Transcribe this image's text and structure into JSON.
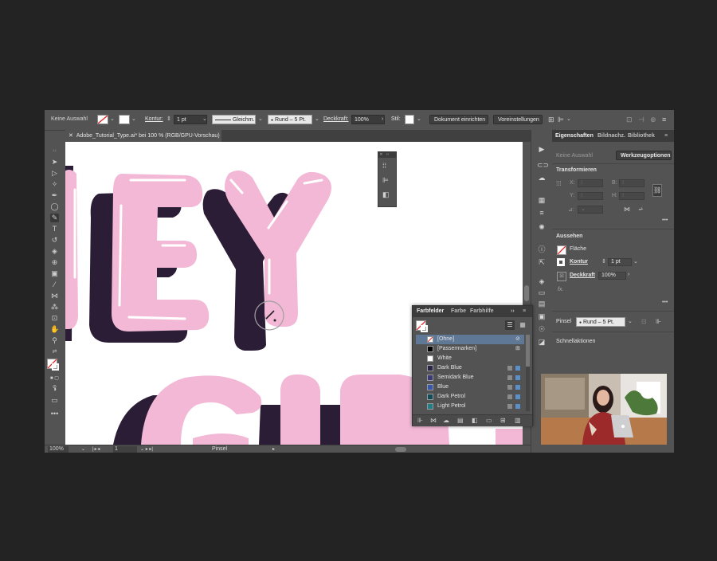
{
  "control_bar": {
    "selection": "Keine Auswahl",
    "stroke_label": "Kontur:",
    "stroke_weight": "1 pt",
    "stroke_profile": "Gleichm.",
    "brush": "Rund – 5 Pt.",
    "opacity_label": "Deckkraft:",
    "opacity": "100%",
    "style_label": "Stil:",
    "doc_setup": "Dokument einrichten",
    "preferences": "Voreinstellungen"
  },
  "document_tab": {
    "close": "✕",
    "title": "Adobe_Tutorial_Type.ai* bei 100 % (RGB/GPU-Vorschau)"
  },
  "status_bar": {
    "zoom": "100%",
    "artboard": "1",
    "tool": "Pinsel"
  },
  "properties": {
    "tabs": [
      "Eigenschaften",
      "Bildnachz.",
      "Bibliothek"
    ],
    "no_selection": "Keine Auswahl",
    "tool_options": "Werkzeugoptionen",
    "transform": "Transformieren",
    "x_label": "X:",
    "y_label": "Y:",
    "b_label": "B:",
    "h_label": "H:",
    "angle_label": "⊿:",
    "appearance": "Aussehen",
    "fill": "Fläche",
    "stroke": "Kontur",
    "stroke_weight": "1 pt",
    "opacity": "Deckkraft",
    "opacity_value": "100%",
    "fx": "fx.",
    "brush_label": "Pinsel",
    "brush_value": "Rund – 5 Pt.",
    "quick_actions": "Schnellaktionen"
  },
  "swatches": {
    "tabs": [
      "Farbfelder",
      "Farbe",
      "Farbhilfe"
    ],
    "items": [
      {
        "name": "[Ohne]",
        "color": "#ffffff",
        "selected": true
      },
      {
        "name": "[Passermarken]",
        "color": "#000000"
      },
      {
        "name": "White",
        "color": "#ffffff"
      },
      {
        "name": "Dark Blue",
        "color": "#2b2547"
      },
      {
        "name": "Semidark Blue",
        "color": "#3b3a78"
      },
      {
        "name": "Blue",
        "color": "#3458b0"
      },
      {
        "name": "Dark Petrol",
        "color": "#0f4d5b"
      },
      {
        "name": "Light Petrol",
        "color": "#1c7f8a"
      }
    ]
  },
  "canvas": {
    "letters_top": [
      "E",
      "Y"
    ],
    "letters_bottom": [
      "G",
      "I",
      "R"
    ],
    "pink": "#f2b8d6",
    "shadow": "#2b1d36"
  }
}
